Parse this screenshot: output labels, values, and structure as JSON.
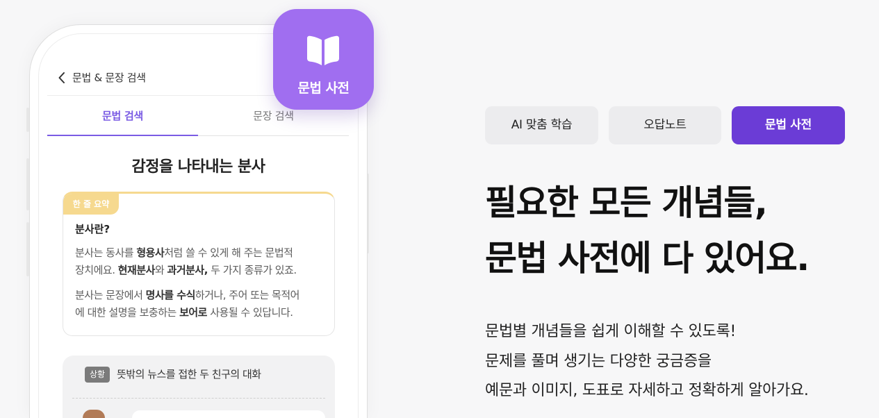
{
  "colors": {
    "page_background": "#f7f7f8",
    "accent_purple": "#6b3cd6",
    "tab_active_purple": "#7a5be4",
    "app_badge_purple": "#a06ef0",
    "summary_yellow": "#f6d98f",
    "situation_badge_gray": "#7b7b7b"
  },
  "phone": {
    "app_badge": {
      "icon": "open-book-icon",
      "label": "문법 사전"
    },
    "header": {
      "back_icon": "chevron-left-icon",
      "title": "문법 & 문장 검색"
    },
    "tabs": [
      {
        "label": "문법 검색",
        "active": true
      },
      {
        "label": "문장 검색",
        "active": false
      }
    ],
    "entry_title": "감정을 나타내는 분사",
    "summary_card": {
      "badge": "한 줄 요약",
      "heading": "분사란?",
      "paragraphs": [
        [
          [
            {
              "text": "분사는 동사를 "
            },
            {
              "text": "형용사",
              "bold": true
            },
            {
              "text": "처럼 쓸 수 있게 해 주는 문법적"
            }
          ],
          [
            {
              "text": "장치에요. "
            },
            {
              "text": "현재분사",
              "bold": true
            },
            {
              "text": "와 "
            },
            {
              "text": "과거분사,",
              "bold": true
            },
            {
              "text": " 두 가지 종류가 있죠."
            }
          ]
        ],
        [
          [
            {
              "text": "분사는 문장에서 "
            },
            {
              "text": "명사를 수식",
              "bold": true
            },
            {
              "text": "하거나, 주어 또는 목적어"
            }
          ],
          [
            {
              "text": "에 대한 설명을 보충하는 "
            },
            {
              "text": "보어로",
              "bold": true
            },
            {
              "text": " 사용될 수 있답니다."
            }
          ]
        ]
      ]
    },
    "situation_card": {
      "badge": "상황",
      "text": "뜻밖의 뉴스를 접한 두 친구의 대화",
      "avatar_icon": "character-avatar-icon"
    }
  },
  "feature_tabs": [
    {
      "label": "AI 맞춤 학습",
      "active": false
    },
    {
      "label": "오답노트",
      "active": false
    },
    {
      "label": "문법 사전",
      "active": true
    }
  ],
  "headline": {
    "lines": [
      "필요한 모든 개념들,",
      "문법 사전에 다 있어요."
    ]
  },
  "description": {
    "lines": [
      "문법별 개념들을 쉽게 이해할 수 있도록!",
      "문제를 풀며 생기는 다양한 궁금증을",
      "예문과 이미지, 도표로 자세하고 정확하게 알아가요."
    ]
  }
}
